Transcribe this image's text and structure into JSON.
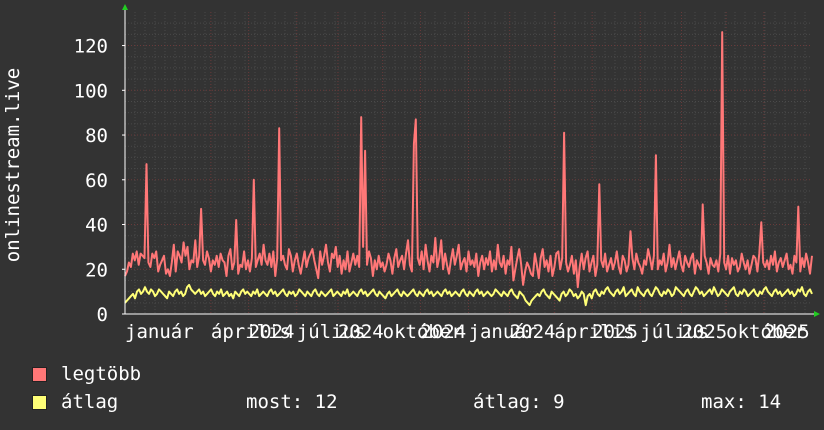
{
  "chart_data": {
    "type": "line",
    "ylabel": "onlinestream.live",
    "ylim": [
      0,
      135
    ],
    "yticks": [
      0,
      20,
      40,
      60,
      80,
      100,
      120
    ],
    "xticks": [
      {
        "label": "január",
        "t": 0.0
      },
      {
        "label": "április",
        "t": 0.125
      },
      {
        "label": "2024",
        "t": 0.18
      },
      {
        "label": "július",
        "t": 0.25
      },
      {
        "label": "2024",
        "t": 0.31
      },
      {
        "label": "október",
        "t": 0.375
      },
      {
        "label": "2024",
        "t": 0.43
      },
      {
        "label": "január",
        "t": 0.5
      },
      {
        "label": "2024",
        "t": 0.56
      },
      {
        "label": "április",
        "t": 0.625
      },
      {
        "label": "2025",
        "t": 0.68
      },
      {
        "label": "július",
        "t": 0.75
      },
      {
        "label": "2025",
        "t": 0.81
      },
      {
        "label": "október",
        "t": 0.875
      },
      {
        "label": "2025",
        "t": 0.93
      }
    ],
    "grid": true,
    "series": [
      {
        "name": "legtöbb",
        "color": "#ff7777",
        "values": [
          17,
          19,
          23,
          21,
          27,
          24,
          28,
          22,
          27,
          26,
          25,
          67,
          23,
          21,
          27,
          25,
          28,
          19,
          22,
          24,
          26,
          18,
          20,
          17,
          23,
          31,
          19,
          28,
          26,
          23,
          32,
          26,
          30,
          20,
          24,
          23,
          33,
          21,
          26,
          47,
          24,
          22,
          28,
          25,
          19,
          24,
          22,
          26,
          21,
          27,
          24,
          23,
          17,
          26,
          29,
          20,
          23,
          42,
          18,
          22,
          21,
          28,
          20,
          24,
          19,
          25,
          60,
          21,
          24,
          27,
          22,
          31,
          24,
          22,
          27,
          21,
          28,
          17,
          25,
          83,
          24,
          26,
          22,
          20,
          29,
          26,
          19,
          24,
          27,
          22,
          18,
          23,
          28,
          21,
          25,
          27,
          29,
          24,
          20,
          16,
          28,
          22,
          26,
          31,
          23,
          19,
          27,
          25,
          30,
          21,
          26,
          18,
          24,
          20,
          28,
          19,
          23,
          27,
          22,
          26,
          21,
          88,
          30,
          73,
          22,
          28,
          25,
          17,
          24,
          20,
          26,
          21,
          23,
          19,
          22,
          27,
          24,
          18,
          25,
          29,
          21,
          24,
          26,
          20,
          27,
          33,
          22,
          19,
          76,
          87,
          25,
          22,
          28,
          20,
          31,
          24,
          19,
          26,
          23,
          34,
          21,
          25,
          33,
          20,
          27,
          22,
          18,
          24,
          29,
          22,
          26,
          31,
          20,
          23,
          25,
          19,
          28,
          22,
          24,
          21,
          27,
          17,
          23,
          26,
          20,
          25,
          22,
          28,
          19,
          24,
          20,
          31,
          23,
          21,
          26,
          18,
          24,
          22,
          30,
          15,
          20,
          25,
          29,
          22,
          13,
          19,
          23,
          21,
          18,
          17,
          27,
          22,
          16,
          25,
          29,
          21,
          24,
          19,
          26,
          17,
          21,
          27,
          28,
          20,
          25,
          81,
          23,
          19,
          22,
          26,
          18,
          24,
          12,
          21,
          27,
          20,
          25,
          28,
          19,
          23,
          26,
          17,
          22,
          58,
          24,
          21,
          27,
          19,
          22,
          25,
          20,
          23,
          28,
          21,
          18,
          26,
          24,
          19,
          22,
          37,
          25,
          20,
          27,
          23,
          21,
          18,
          24,
          22,
          29,
          25,
          20,
          26,
          71,
          20,
          24,
          22,
          27,
          19,
          23,
          31,
          21,
          25,
          20,
          24,
          28,
          22,
          19,
          26,
          23,
          21,
          25,
          27,
          18,
          24,
          22,
          20,
          49,
          26,
          23,
          18,
          25,
          22,
          21,
          24,
          19,
          27,
          126,
          23,
          20,
          26,
          18,
          25,
          22,
          24,
          19,
          21,
          27,
          23,
          20,
          24,
          18,
          22,
          26,
          25,
          19,
          27,
          41,
          23,
          21,
          24,
          20,
          26,
          22,
          28,
          19,
          23,
          25,
          21,
          24,
          27,
          20,
          22,
          18,
          26,
          23,
          48,
          19,
          25,
          21,
          27,
          23,
          18,
          26
        ]
      },
      {
        "name": "átlag",
        "color": "#ffff77",
        "values": [
          5,
          6,
          7,
          8,
          9,
          7,
          10,
          11,
          9,
          10,
          12,
          10,
          9,
          11,
          10,
          8,
          9,
          11,
          10,
          9,
          8,
          7,
          10,
          9,
          8,
          10,
          11,
          9,
          10,
          8,
          9,
          12,
          13,
          11,
          10,
          9,
          10,
          11,
          9,
          10,
          8,
          9,
          10,
          11,
          9,
          8,
          10,
          9,
          11,
          8,
          9,
          10,
          8,
          9,
          7,
          10,
          9,
          8,
          10,
          11,
          9,
          10,
          9,
          8,
          10,
          9,
          11,
          8,
          9,
          10,
          9,
          8,
          10,
          11,
          9,
          10,
          8,
          9,
          10,
          11,
          9,
          8,
          10,
          9,
          10,
          8,
          9,
          11,
          10,
          9,
          8,
          10,
          9,
          8,
          10,
          11,
          9,
          8,
          10,
          9,
          8,
          9,
          10,
          11,
          8,
          9,
          10,
          9,
          8,
          10,
          9,
          11,
          8,
          9,
          10,
          9,
          8,
          10,
          11,
          9,
          10,
          8,
          9,
          10,
          11,
          9,
          8,
          10,
          9,
          8,
          7,
          9,
          10,
          8,
          9,
          10,
          11,
          9,
          8,
          10,
          9,
          8,
          9,
          10,
          11,
          9,
          8,
          10,
          9,
          8,
          10,
          11,
          9,
          10,
          8,
          9,
          10,
          9,
          8,
          10,
          11,
          9,
          10,
          8,
          9,
          10,
          9,
          8,
          10,
          11,
          9,
          8,
          10,
          9,
          8,
          10,
          11,
          9,
          10,
          8,
          9,
          10,
          9,
          8,
          9,
          11,
          10,
          9,
          8,
          10,
          9,
          8,
          10,
          11,
          9,
          8,
          7,
          10,
          9,
          8,
          6,
          5,
          4,
          6,
          7,
          8,
          9,
          8,
          10,
          11,
          9,
          8,
          7,
          10,
          9,
          8,
          7,
          6,
          9,
          10,
          8,
          9,
          11,
          10,
          8,
          9,
          7,
          8,
          10,
          9,
          4,
          8,
          9,
          7,
          10,
          11,
          9,
          8,
          10,
          9,
          11,
          12,
          10,
          9,
          8,
          10,
          11,
          9,
          10,
          12,
          8,
          9,
          10,
          11,
          9,
          8,
          12,
          10,
          9,
          8,
          10,
          11,
          9,
          8,
          10,
          12,
          11,
          9,
          8,
          10,
          9,
          11,
          10,
          8,
          9,
          12,
          11,
          10,
          9,
          8,
          10,
          11,
          9,
          8,
          10,
          12,
          11,
          9,
          10,
          8,
          9,
          10,
          11,
          9,
          12,
          10,
          8,
          9,
          11,
          10,
          9,
          8,
          10,
          11,
          12,
          9,
          8,
          10,
          9,
          11,
          10,
          8,
          9,
          10,
          11,
          9,
          8,
          10,
          9,
          11,
          12,
          10,
          9,
          8,
          10,
          11,
          9,
          10,
          8,
          9,
          10,
          11,
          9,
          10,
          8,
          9,
          11,
          10,
          12,
          9,
          8,
          10,
          11,
          9
        ]
      }
    ]
  },
  "legend": {
    "items": [
      {
        "label": "legtöbb",
        "color": "#ff7777"
      },
      {
        "label": "átlag",
        "color": "#ffff77"
      }
    ],
    "stats": {
      "most": "most: 12",
      "atlag": "átlag: 9",
      "max": "max: 14"
    }
  }
}
